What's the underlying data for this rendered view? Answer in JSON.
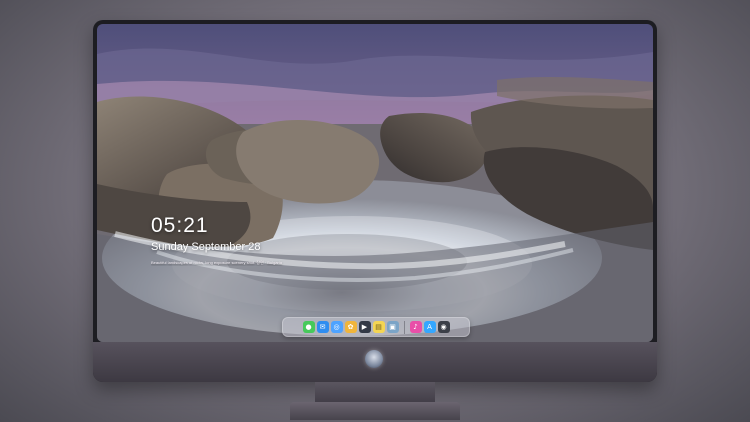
{
  "lock_screen": {
    "time": "05:21",
    "date": "Sunday September  28",
    "caption": "Beautiful landscapes of rocks, long exposure scenery shot. 장면 · Bulgaria"
  },
  "dock": {
    "items": [
      {
        "name": "messages-icon",
        "glyph": "●",
        "color": "#47c95b"
      },
      {
        "name": "mail-icon",
        "glyph": "✉",
        "color": "#2f8df0"
      },
      {
        "name": "safari-icon",
        "glyph": "◎",
        "color": "#4ea3ff"
      },
      {
        "name": "photos-icon",
        "glyph": "✿",
        "color": "#f0b53b"
      },
      {
        "name": "video-icon",
        "glyph": "▶",
        "color": "#333946"
      },
      {
        "name": "notes-icon",
        "glyph": "▤",
        "color": "#f4d553"
      },
      {
        "name": "preview-icon",
        "glyph": "▣",
        "color": "#7ba4c7"
      },
      {
        "name": "music-icon",
        "glyph": "♪",
        "color": "#e84fa8"
      },
      {
        "name": "app-store-icon",
        "glyph": "A",
        "color": "#34a7ff"
      },
      {
        "name": "camera-icon",
        "glyph": "◉",
        "color": "#3b3f48"
      }
    ]
  },
  "colors": {
    "sky_top": "#5b5a86",
    "sky_mid": "#8b6c99",
    "sky_glow": "#c78fb1",
    "rock": "#5c5650",
    "water": "#dce4ee"
  }
}
